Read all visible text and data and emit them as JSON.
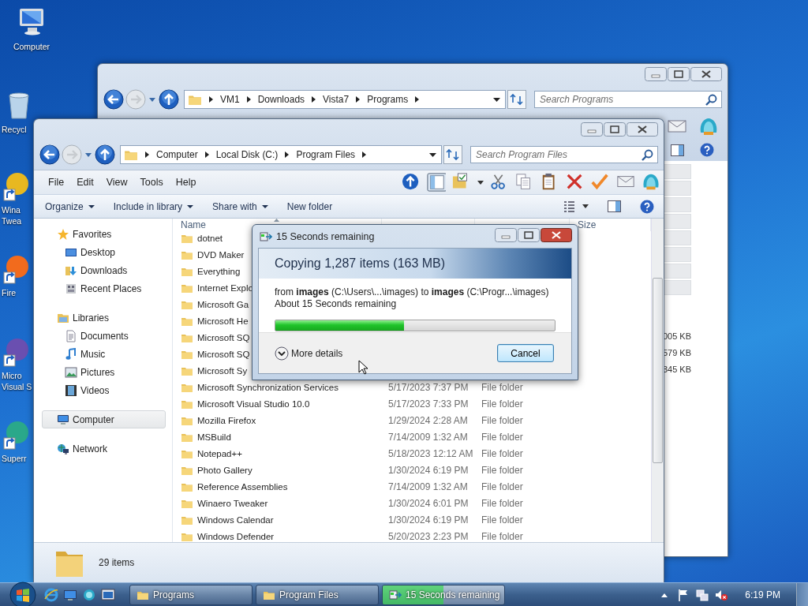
{
  "desktop_icons": [
    {
      "kind": "computer",
      "label": [
        "Computer"
      ]
    },
    {
      "kind": "recycle",
      "label": [
        "Recycl"
      ]
    },
    {
      "kind": "shortcut",
      "color": "#e8b820",
      "label": [
        "Wina",
        "Twea"
      ]
    },
    {
      "kind": "shortcut",
      "color": "#f26b1d",
      "label": [
        "Fire"
      ]
    },
    {
      "kind": "shortcut",
      "color": "#6a4fb0",
      "label": [
        "Micro",
        "Visual S"
      ]
    },
    {
      "kind": "shortcut",
      "color": "#2aa88a",
      "label": [
        "Superr"
      ]
    }
  ],
  "back_window": {
    "breadcrumbs": [
      "VM1",
      "Downloads",
      "Vista7",
      "Programs"
    ],
    "search": {
      "placeholder": "Search Programs"
    },
    "sizes": [
      "005 KB",
      "579 KB",
      "345 KB"
    ]
  },
  "front_window": {
    "breadcrumbs": [
      "Computer",
      "Local Disk (C:)",
      "Program Files"
    ],
    "search": {
      "placeholder": "Search Program Files"
    },
    "menu": [
      "File",
      "Edit",
      "View",
      "Tools",
      "Help"
    ],
    "commands": [
      {
        "label": "Organize",
        "dropdown": true
      },
      {
        "label": "Include in library",
        "dropdown": true
      },
      {
        "label": "Share with",
        "dropdown": true
      },
      {
        "label": "New folder",
        "dropdown": false
      }
    ],
    "nav": [
      {
        "kind": "star",
        "label": "Favorites",
        "selected": false,
        "children": [
          {
            "kind": "desktop",
            "label": "Desktop",
            "selected": false
          },
          {
            "kind": "downloads",
            "label": "Downloads",
            "selected": false
          },
          {
            "kind": "recent",
            "label": "Recent Places",
            "selected": false
          }
        ]
      },
      {
        "kind": "libraries",
        "label": "Libraries",
        "selected": false,
        "children": [
          {
            "kind": "document",
            "label": "Documents",
            "selected": false
          },
          {
            "kind": "music",
            "label": "Music",
            "selected": false
          },
          {
            "kind": "pictures",
            "label": "Pictures",
            "selected": false
          },
          {
            "kind": "videos",
            "label": "Videos",
            "selected": false
          }
        ]
      },
      {
        "kind": "computer",
        "label": "Computer",
        "selected": true
      },
      {
        "kind": "network",
        "label": "Network",
        "selected": false
      }
    ],
    "columns": [
      "Name",
      "Size"
    ],
    "rows": [
      {
        "name": "dotnet"
      },
      {
        "name": "DVD Maker"
      },
      {
        "name": "Everything"
      },
      {
        "name": "Internet Explo"
      },
      {
        "name": "Microsoft Ga"
      },
      {
        "name": "Microsoft He"
      },
      {
        "name": "Microsoft SQ"
      },
      {
        "name": "Microsoft SQ"
      },
      {
        "name": "Microsoft Sy"
      },
      {
        "name": "Microsoft Synchronization Services",
        "date": "5/17/2023 7:37 PM",
        "type": "File folder"
      },
      {
        "name": "Microsoft Visual Studio 10.0",
        "date": "5/17/2023 7:33 PM",
        "type": "File folder"
      },
      {
        "name": "Mozilla Firefox",
        "date": "1/29/2024 2:28 AM",
        "type": "File folder"
      },
      {
        "name": "MSBuild",
        "date": "7/14/2009 1:32 AM",
        "type": "File folder"
      },
      {
        "name": "Notepad++",
        "date": "5/18/2023 12:12 AM",
        "type": "File folder"
      },
      {
        "name": "Photo Gallery",
        "date": "1/30/2024 6:19 PM",
        "type": "File folder"
      },
      {
        "name": "Reference Assemblies",
        "date": "7/14/2009 1:32 AM",
        "type": "File folder"
      },
      {
        "name": "Winaero Tweaker",
        "date": "1/30/2024 6:01 PM",
        "type": "File folder"
      },
      {
        "name": "Windows Calendar",
        "date": "1/30/2024 6:19 PM",
        "type": "File folder"
      },
      {
        "name": "Windows Defender",
        "date": "5/20/2023 2:23 PM",
        "type": "File folder"
      }
    ],
    "status": "29 items"
  },
  "dialog": {
    "title": "15 Seconds remaining",
    "heading": "Copying 1,287 items (163 MB)",
    "detail": "from **images** (C:\\Users\\...\\images)  to **images** (C:\\Progr...\\images)",
    "remaining": "About 15 Seconds remaining",
    "progress": {
      "level": 0.46
    },
    "more": "More details",
    "cancel": "Cancel"
  },
  "taskbar": {
    "buttons": [
      {
        "kind": "folder",
        "label": "Programs"
      },
      {
        "kind": "folder",
        "label": "Program Files"
      },
      {
        "kind": "copy",
        "label": "15 Seconds remaining",
        "level": 0.5
      }
    ],
    "clock": "6:19 PM"
  }
}
